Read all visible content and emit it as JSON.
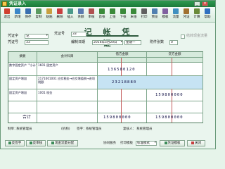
{
  "window": {
    "title": "凭证录入"
  },
  "toolbar": [
    {
      "label": "退出",
      "icon": "exit-icon",
      "color": "#d04030"
    },
    {
      "label": "新增",
      "icon": "new-icon",
      "color": "#3a86c8"
    },
    {
      "label": "保存",
      "icon": "save-icon",
      "color": "#3a6fb0"
    },
    {
      "label": "复制",
      "icon": "copy-icon",
      "color": "#5a9a60"
    },
    {
      "label": "粘贴",
      "icon": "paste-icon",
      "color": "#c8a040"
    },
    {
      "label": "删除",
      "icon": "delete-icon",
      "color": "#c84040"
    },
    {
      "label": "插入",
      "icon": "insert-icon",
      "color": "#4a9a8a"
    },
    {
      "label": "余额",
      "icon": "balance-icon",
      "color": "#5a7ab0"
    },
    {
      "label": "审核",
      "icon": "audit-icon",
      "color": "#b05050"
    },
    {
      "label": "首张",
      "icon": "first-icon",
      "color": "#3a8a3a"
    },
    {
      "label": "上张",
      "icon": "prev-icon",
      "color": "#3a8a3a"
    },
    {
      "label": "下张",
      "icon": "next-icon",
      "color": "#3a8a3a"
    },
    {
      "label": "末张",
      "icon": "last-icon",
      "color": "#3a8a3a"
    },
    {
      "label": "打印",
      "icon": "print-icon",
      "color": "#606060"
    },
    {
      "label": "预览",
      "icon": "preview-icon",
      "color": "#5080b0"
    },
    {
      "label": "模板",
      "icon": "template-icon",
      "color": "#8060a0"
    },
    {
      "label": "流量",
      "icon": "flow-icon",
      "color": "#4090c0"
    },
    {
      "label": "凭证",
      "icon": "voucher-icon",
      "color": "#a07030"
    },
    {
      "label": "计算",
      "icon": "calc-icon",
      "color": "#6a8a3a"
    },
    {
      "label": "帮助",
      "icon": "help-icon",
      "color": "#3070c0"
    }
  ],
  "header": {
    "title": "记 帐 凭 证",
    "voucher_word_label": "凭证字",
    "voucher_word_value": "记",
    "voucher_no_label": "凭证号",
    "voucher_no_value": "33",
    "voucher_no_label2": "凭证号",
    "voucher_no_value2": "33",
    "date_label": "编制日期",
    "date_value": "2016年5月20日",
    "weekday": "星期一",
    "attachment_label": "附件张数",
    "attachment_value": "0",
    "cash_flow_label": "结转现金流量"
  },
  "grid": {
    "col_summary": "摘要",
    "col_account": "会计科目",
    "col_debit": "借方金额",
    "col_credit": "贷方金额",
    "total_label": "合计",
    "rows": [
      {
        "summary": "数字固定资产 '\"小计\"1",
        "account": "1601 固定资产",
        "debit": "136580120",
        "credit": ""
      },
      {
        "summary": "固定资产增加",
        "account": "2171001001 应交税金→应交增值税→进项税额",
        "debit": "23218880",
        "credit": ""
      },
      {
        "summary": "固定资产增加",
        "account": "1001 现金",
        "debit": "",
        "credit": "159800000"
      }
    ],
    "total_debit": "159800000",
    "total_credit": "159800000"
  },
  "footer": {
    "maker_label": "制单：",
    "maker": "系统管理员",
    "org_label": "(机构)",
    "approve_label": "签字：",
    "approve": "系统管理员",
    "post_label": "复核人：",
    "post": "系统管理员",
    "btn_more_settings": "反签字",
    "btn_repost": "反审核",
    "btn_cash_flow": "现金流量分配",
    "mode_label": "协同服务",
    "print_label": "打印模板",
    "print_value": "标准模式",
    "btn_template": "凭证模板",
    "btn_close": "关闭"
  }
}
